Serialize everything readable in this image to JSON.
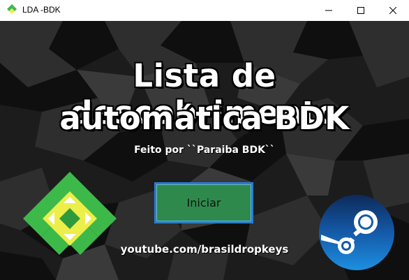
{
  "window": {
    "title": "LDA -BDK",
    "icon": "lda-app-icon",
    "controls": [
      "minimize-icon",
      "maximize-icon",
      "close-icon"
    ]
  },
  "main": {
    "headline_line1": "Lista de descobrimento",
    "headline_line2": "automática BDK",
    "credit": "Feito por ``Paraiba BDK``",
    "start_button_label": "Iniciar",
    "youtube_link": "youtube.com/brasildropkeys"
  },
  "icons": {
    "left_logo": "lda-logo-icon",
    "right_logo": "steam-logo-icon"
  },
  "colors": {
    "background": "#1b1b1b",
    "start_button": "#2e8a4c",
    "start_button_border": "#2a7dd8",
    "logo_green": "#3db94a",
    "logo_yellow": "#ecee4a",
    "steam_blue": "#1b6fc2"
  }
}
